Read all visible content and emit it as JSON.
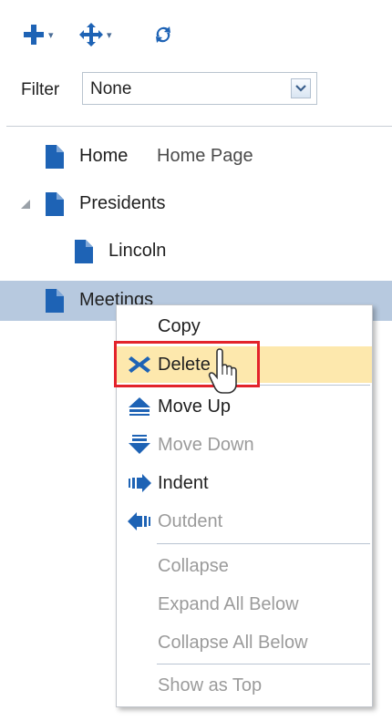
{
  "toolbar": {
    "buttons": [
      {
        "name": "add-button",
        "icon": "add-icon",
        "has_menu": true
      },
      {
        "name": "move-button",
        "icon": "move-icon",
        "has_menu": true
      },
      {
        "name": "refresh-button",
        "icon": "refresh-icon",
        "has_menu": false
      }
    ],
    "caret": "▾"
  },
  "filter": {
    "label": "Filter",
    "value": "None"
  },
  "tree": {
    "rows": [
      {
        "label": "Home",
        "description": "Home Page",
        "icon": "page-icon"
      },
      {
        "label": "Presidents",
        "icon": "page-icon",
        "expanded": true
      },
      {
        "label": "Lincoln",
        "icon": "page-icon"
      },
      {
        "label": "Meetings",
        "icon": "page-icon",
        "selected": true
      }
    ]
  },
  "context_menu": {
    "items": [
      {
        "label": "Copy",
        "enabled": true
      },
      {
        "label": "Delete",
        "enabled": true,
        "icon": "delete-icon",
        "highlighted": true
      },
      {
        "label": "Move Up",
        "enabled": true,
        "icon": "move-up-icon"
      },
      {
        "label": "Move Down",
        "enabled": false,
        "icon": "move-down-icon"
      },
      {
        "label": "Indent",
        "enabled": true,
        "icon": "indent-icon"
      },
      {
        "label": "Outdent",
        "enabled": false,
        "icon": "outdent-icon"
      },
      {
        "label": "Collapse",
        "enabled": false
      },
      {
        "label": "Expand All Below",
        "enabled": false
      },
      {
        "label": "Collapse All Below",
        "enabled": false
      },
      {
        "label": "Show as Top",
        "enabled": false
      }
    ]
  },
  "colors": {
    "icon_blue": "#1e63b5",
    "selection": "#b7c9df",
    "menu_highlight": "#fde8ad",
    "annotation_red": "#e3232b",
    "disabled_text": "#9b9b9b"
  }
}
